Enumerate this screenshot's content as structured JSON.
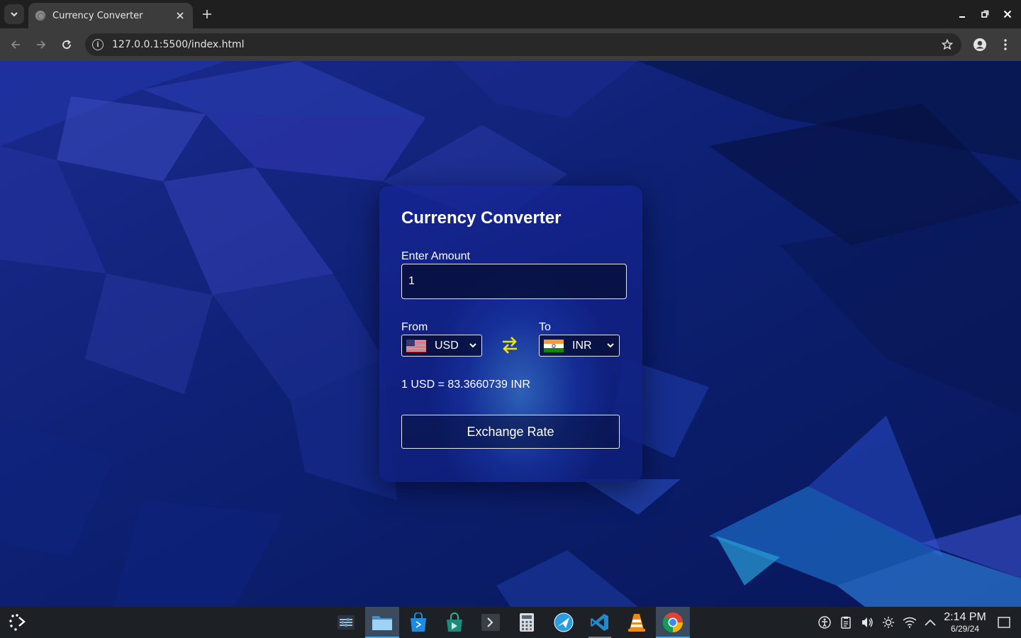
{
  "browser": {
    "tab_title": "Currency Converter",
    "url": "127.0.0.1:5500/index.html"
  },
  "converter": {
    "title": "Currency Converter",
    "amount_label": "Enter Amount",
    "amount_value": "1",
    "from_label": "From",
    "from_currency": "USD",
    "from_flag": "us-flag-icon",
    "to_label": "To",
    "to_currency": "INR",
    "to_flag": "india-flag-icon",
    "rate_text": "1 USD = 83.3660739 INR",
    "button_label": "Exchange Rate"
  },
  "taskbar": {
    "apps": [
      "system-settings-icon",
      "file-manager-icon",
      "discover-store-icon",
      "store-icon",
      "terminal-icon",
      "calculator-icon",
      "browser-icon",
      "vscode-icon",
      "vlc-icon",
      "chrome-icon"
    ],
    "tray": [
      "accessibility-icon",
      "clipboard-icon",
      "volume-icon",
      "brightness-icon",
      "wifi-icon",
      "tray-expand-icon"
    ],
    "time": "2:14 PM",
    "date": "6/29/24"
  },
  "colors": {
    "swap_arrow": "#f2e600",
    "card_bg": "#1a2a8c",
    "accent": "#3daee9"
  }
}
